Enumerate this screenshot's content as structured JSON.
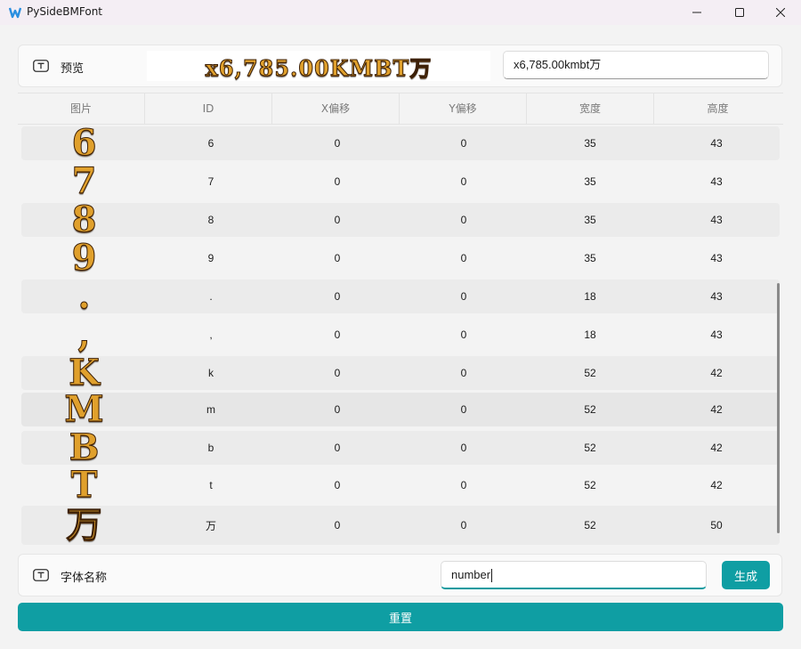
{
  "window": {
    "title": "PySideBMFont"
  },
  "preview": {
    "label": "预览",
    "image_text": "x6,785.00KMBT万",
    "input_value": "x6,785.00kmbt万"
  },
  "table": {
    "headers": [
      "图片",
      "ID",
      "X偏移",
      "Y偏移",
      "宽度",
      "高度"
    ],
    "rows": [
      {
        "glyph": "6",
        "id": "6",
        "x_offset": "0",
        "y_offset": "0",
        "width": "35",
        "height": "43"
      },
      {
        "glyph": "7",
        "id": "7",
        "x_offset": "0",
        "y_offset": "0",
        "width": "35",
        "height": "43"
      },
      {
        "glyph": "8",
        "id": "8",
        "x_offset": "0",
        "y_offset": "0",
        "width": "35",
        "height": "43"
      },
      {
        "glyph": "9",
        "id": "9",
        "x_offset": "0",
        "y_offset": "0",
        "width": "35",
        "height": "43"
      },
      {
        "glyph": ".",
        "id": ".",
        "x_offset": "0",
        "y_offset": "0",
        "width": "18",
        "height": "43"
      },
      {
        "glyph": ",",
        "id": ",",
        "x_offset": "0",
        "y_offset": "0",
        "width": "18",
        "height": "43"
      },
      {
        "glyph": "K",
        "id": "k",
        "x_offset": "0",
        "y_offset": "0",
        "width": "52",
        "height": "42"
      },
      {
        "glyph": "M",
        "id": "m",
        "x_offset": "0",
        "y_offset": "0",
        "width": "52",
        "height": "42"
      },
      {
        "glyph": "B",
        "id": "b",
        "x_offset": "0",
        "y_offset": "0",
        "width": "52",
        "height": "42"
      },
      {
        "glyph": "T",
        "id": "t",
        "x_offset": "0",
        "y_offset": "0",
        "width": "52",
        "height": "42"
      },
      {
        "glyph": "万",
        "id": "万",
        "x_offset": "0",
        "y_offset": "0",
        "width": "52",
        "height": "50"
      }
    ]
  },
  "font_name": {
    "label": "字体名称",
    "input_value": "number",
    "generate_label": "生成"
  },
  "reset_label": "重置",
  "colors": {
    "accent": "#0f9ea3",
    "glyph_gold": "#e0a02c",
    "glyph_outline": "#3c2008"
  }
}
